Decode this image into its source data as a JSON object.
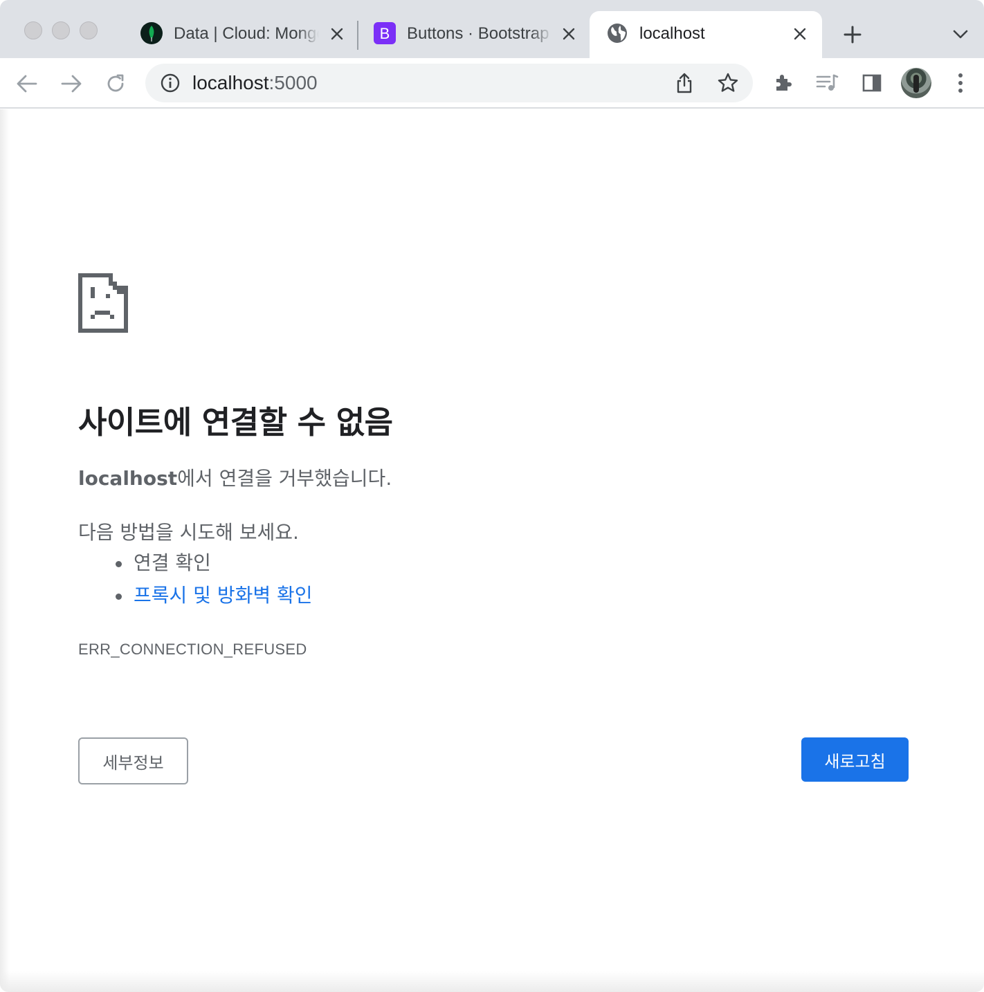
{
  "tabs": [
    {
      "title": "Data | Cloud: MongoDB Cloud",
      "favicon": "mongodb-leaf-icon",
      "active": false
    },
    {
      "title": "Buttons · Bootstrap",
      "favicon": "bootstrap-icon",
      "favicon_letter": "B",
      "active": false
    },
    {
      "title": "localhost",
      "favicon": "globe-icon",
      "active": true
    }
  ],
  "toolbar": {
    "url_host": "localhost",
    "url_port": ":5000"
  },
  "error_page": {
    "heading": "사이트에 연결할 수 없음",
    "host_bold": "localhost",
    "desc_rest": "에서 연결을 거부했습니다.",
    "suggest_head": "다음 방법을 시도해 보세요.",
    "suggestions": [
      "연결 확인",
      "프록시 및 방화벽 확인"
    ],
    "error_code": "ERR_CONNECTION_REFUSED",
    "details_label": "세부정보",
    "reload_label": "새로고침"
  },
  "colors": {
    "accent": "#1a73e8",
    "bootstrap": "#7b2ff7",
    "mongodb": "#13aa52",
    "text_secondary": "#5f6368",
    "tabstrip": "#dee1e6"
  }
}
